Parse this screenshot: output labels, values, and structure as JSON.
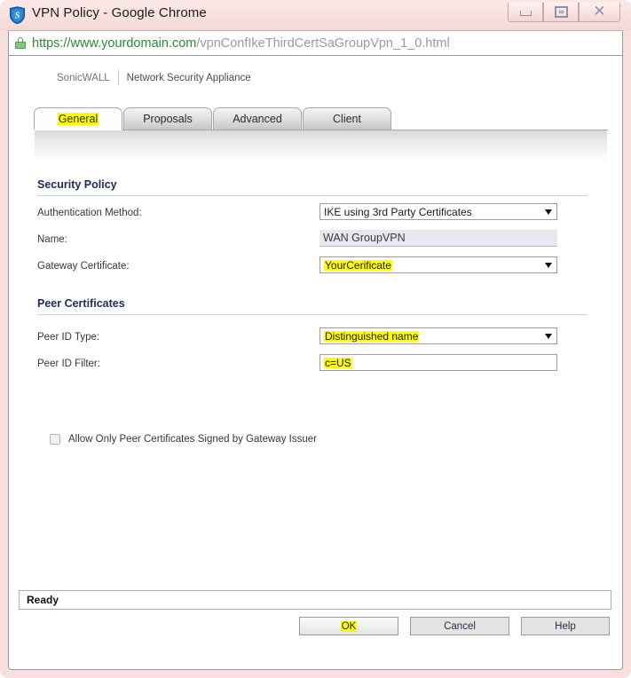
{
  "window": {
    "title": "VPN Policy - Google Chrome",
    "app_icon": "sonicwall-shield-icon",
    "controls": {
      "minimize": "minimize-icon",
      "maximize": "maximize-icon",
      "close": "close-icon"
    }
  },
  "urlbar": {
    "lock_icon": "lock-icon",
    "host": "https://www.yourdomain.com",
    "path": "/vpnConfIkeThirdCertSaGroupVpn_1_0.html"
  },
  "brand": {
    "vendor": "SonicWALL",
    "product": "Network Security Appliance"
  },
  "tabs": [
    {
      "label": "General",
      "active": true,
      "highlighted": true
    },
    {
      "label": "Proposals",
      "active": false,
      "highlighted": false
    },
    {
      "label": "Advanced",
      "active": false,
      "highlighted": false
    },
    {
      "label": "Client",
      "active": false,
      "highlighted": false
    }
  ],
  "sections": {
    "security_policy": {
      "title": "Security Policy",
      "fields": {
        "authentication_method": {
          "label": "Authentication Method:",
          "value": "IKE using 3rd Party Certificates",
          "type": "select",
          "highlighted": false
        },
        "name": {
          "label": "Name:",
          "value": "WAN GroupVPN",
          "type": "readonly",
          "highlighted": false
        },
        "gateway_certificate": {
          "label": "Gateway Certificate:",
          "value": "YourCerificate",
          "type": "select",
          "highlighted": true
        }
      }
    },
    "peer_certificates": {
      "title": "Peer Certificates",
      "fields": {
        "peer_id_type": {
          "label": "Peer ID Type:",
          "value": "Distinguished name",
          "type": "select",
          "highlighted": true
        },
        "peer_id_filter": {
          "label": "Peer ID Filter:",
          "value": "c=US",
          "type": "text",
          "highlighted": true
        },
        "allow_only_signed": {
          "label": "Allow Only Peer Certificates Signed by Gateway Issuer",
          "checked": false,
          "type": "checkbox"
        }
      }
    }
  },
  "statusbar": {
    "text": "Ready"
  },
  "buttons": {
    "ok": {
      "label": "OK",
      "highlighted": true
    },
    "cancel": {
      "label": "Cancel",
      "highlighted": false
    },
    "help": {
      "label": "Help",
      "highlighted": false
    }
  },
  "colors": {
    "highlight": "#ffff00",
    "section_header": "#1f2b5b",
    "url_host": "#2d8a2d",
    "url_path": "#9b9b9b",
    "frame": "#f7dfdd"
  }
}
